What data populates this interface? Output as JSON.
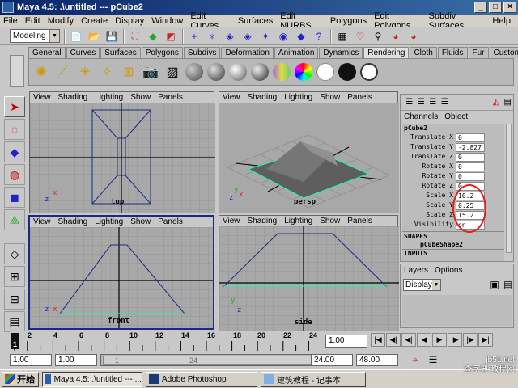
{
  "window": {
    "title": "Maya 4.5: .\\untitled  ---  pCube2"
  },
  "menu": [
    "File",
    "Edit",
    "Modify",
    "Create",
    "Display",
    "Window",
    "Edit Curves",
    "Surfaces",
    "Edit NURBS",
    "Polygons",
    "Edit Polygons",
    "Subdiv Surfaces",
    "Help"
  ],
  "toolbar": {
    "mode": "Modeling"
  },
  "shelf": {
    "tabs": [
      "General",
      "Curves",
      "Surfaces",
      "Polygons",
      "Subdivs",
      "Deformation",
      "Animation",
      "Dynamics",
      "Rendering",
      "Cloth",
      "Fluids",
      "Fur",
      "Custom"
    ],
    "active_tab": "Rendering"
  },
  "viewport_menu": [
    "View",
    "Shading",
    "Lighting",
    "Show",
    "Panels"
  ],
  "viewports": {
    "top": {
      "label": "top"
    },
    "persp": {
      "label": "persp"
    },
    "front": {
      "label": "front"
    },
    "side": {
      "label": "side"
    }
  },
  "channel_box": {
    "menu": [
      "Channels",
      "Object"
    ],
    "object": "pCube2",
    "channels": [
      {
        "label": "Translate X",
        "value": "0"
      },
      {
        "label": "Translate Y",
        "value": "-2.827"
      },
      {
        "label": "Translate Z",
        "value": "0"
      },
      {
        "label": "Rotate X",
        "value": "0"
      },
      {
        "label": "Rotate Y",
        "value": "0"
      },
      {
        "label": "Rotate Z",
        "value": "0"
      },
      {
        "label": "Scale X",
        "value": "10.2"
      },
      {
        "label": "Scale Y",
        "value": "0.25"
      },
      {
        "label": "Scale Z",
        "value": "15.2"
      },
      {
        "label": "Visibility",
        "value": "on"
      }
    ],
    "shapes_header": "SHAPES",
    "shape_name": "pCubeShape2",
    "inputs_header": "INPUTS"
  },
  "layers": {
    "menu": [
      "Layers",
      "Options"
    ],
    "display": "Display"
  },
  "timeline": {
    "ticks": [
      "2",
      "4",
      "6",
      "8",
      "10",
      "12",
      "14",
      "16",
      "18",
      "20",
      "22",
      "24"
    ],
    "current_frame": "1.00",
    "start_frame": "1"
  },
  "range": {
    "start": "1.00",
    "playback_start": "1.00",
    "slider_left": "1",
    "slider_right": "24",
    "playback_end": "24.00",
    "end": "48.00"
  },
  "taskbar": {
    "start": "开始",
    "items": [
      "Maya 4.5: .\\untitled  ---  ...",
      "Adobe Photoshop",
      "建筑教程 - 记事本"
    ]
  },
  "watermark": {
    "line1": "jb51.net",
    "line2": "查字典 教程网"
  }
}
